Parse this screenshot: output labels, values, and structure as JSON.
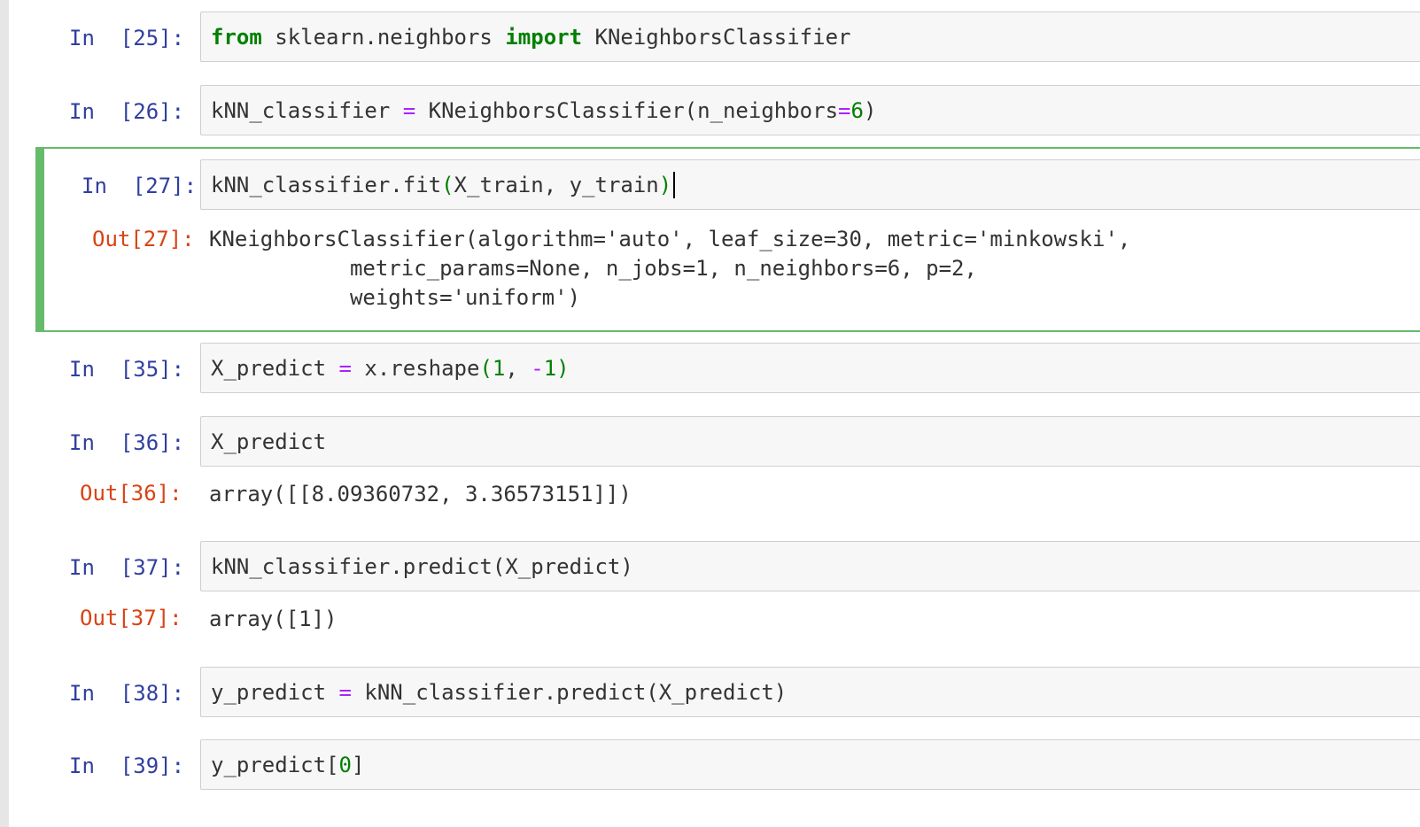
{
  "cells": [
    {
      "prompt": "In  [25]:",
      "code": {
        "t1": "from",
        "t2": " sklearn.neighbors ",
        "t3": "import",
        "t4": " KNeighborsClassifier"
      }
    },
    {
      "prompt": "In  [26]:",
      "code": {
        "t1": "kNN_classifier ",
        "t2": "=",
        "t3": " KNeighborsClassifier(n_neighbors",
        "t4": "=",
        "t5": "6",
        "t6": ")"
      }
    },
    {
      "prompt": "In  [27]:",
      "code": {
        "t1": "kNN_classifier.fit",
        "t2": "(",
        "t3": "X_train, y_train",
        "t4": ")"
      },
      "out_prompt": "Out[27]:",
      "output_lines": [
        "KNeighborsClassifier(algorithm='auto', leaf_size=30, metric='minkowski',",
        "           metric_params=None, n_jobs=1, n_neighbors=6, p=2,",
        "           weights='uniform')"
      ]
    },
    {
      "prompt": "In  [35]:",
      "code": {
        "t1": "X_predict ",
        "t2": "=",
        "t3": " x.reshape",
        "t4": "(",
        "t5": "1",
        "t6": ", ",
        "t7": "-",
        "t8": "1",
        "t9": ")"
      }
    },
    {
      "prompt": "In  [36]:",
      "code": {
        "t1": "X_predict"
      },
      "out_prompt": "Out[36]:",
      "output": "array([[8.09360732, 3.36573151]])"
    },
    {
      "prompt": "In  [37]:",
      "code": {
        "t1": "kNN_classifier.predict(X_predict)"
      },
      "out_prompt": "Out[37]:",
      "output": "array([1])"
    },
    {
      "prompt": "In  [38]:",
      "code": {
        "t1": "y_predict ",
        "t2": "=",
        "t3": " kNN_classifier.predict(X_predict)"
      }
    },
    {
      "prompt": "In  [39]:",
      "code": {
        "t1": "y_predict",
        "t2": "[",
        "t3": "0",
        "t4": "]"
      }
    }
  ],
  "colors": {
    "in_prompt": "#303f9f",
    "out_prompt": "#d84315",
    "keyword": "#008000",
    "operator": "#aa22ff",
    "selected_border": "#66bb6a"
  }
}
